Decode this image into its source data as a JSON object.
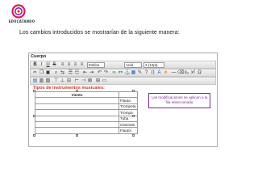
{
  "logo": {
    "text": "EDUCATANDO"
  },
  "caption": "Los cambios introducidos se mostrarían de la siguiente manera:",
  "editor": {
    "title": "Cuerpo",
    "toolbar": {
      "style_select": "Estilos",
      "font_select": "Arial",
      "size_select": "3 (12pt)"
    },
    "content": {
      "heading": "Tipos de Instrumentos musicales:",
      "table": {
        "header": "Viento",
        "rows": [
          "Flauta",
          "Trompeta",
          "Trompa",
          "Tuba",
          "Clarinete",
          "Flautín"
        ]
      },
      "note": "Las modificaciones se aplican a la fila seleccionada"
    }
  }
}
